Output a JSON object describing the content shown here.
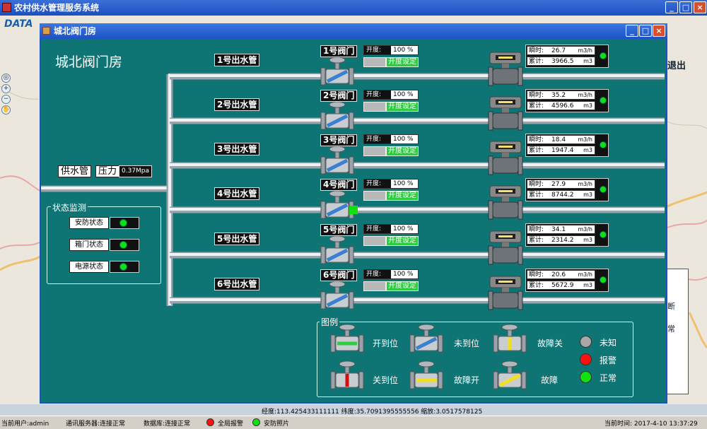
{
  "app": {
    "title": "农村供水管理服务系统",
    "logo": "DATA",
    "exit": "退出"
  },
  "map_labels": {
    "right_1": "断",
    "right_2": "常"
  },
  "window": {
    "title": "城北阀门房",
    "heading": "城北阀门房"
  },
  "supply": {
    "label": "供水管",
    "pressure_label": "压力",
    "pressure_value": "0.37Mpa"
  },
  "status_panel": {
    "title": "状态监测",
    "items": [
      {
        "label": "安防状态"
      },
      {
        "label": "箱门状态"
      },
      {
        "label": "电源状态"
      }
    ]
  },
  "rows": [
    {
      "pipe": "1号出水管",
      "valve": "1号阀门",
      "open_label": "开度:",
      "open_value": "100 %",
      "set_label": "开度设定",
      "inst_label": "瞬时:",
      "inst_value": "26.7",
      "inst_unit": "m3/h",
      "total_label": "累计:",
      "total_value": "3966.5",
      "total_unit": "m3",
      "valve_state": "未到位"
    },
    {
      "pipe": "2号出水管",
      "valve": "2号阀门",
      "open_label": "开度:",
      "open_value": "100 %",
      "set_label": "开度设定",
      "inst_label": "瞬时:",
      "inst_value": "35.2",
      "inst_unit": "m3/h",
      "total_label": "累计:",
      "total_value": "4596.6",
      "total_unit": "m3",
      "valve_state": "未到位"
    },
    {
      "pipe": "3号出水管",
      "valve": "3号阀门",
      "open_label": "开度:",
      "open_value": "100 %",
      "set_label": "开度设定",
      "inst_label": "瞬时:",
      "inst_value": "18.4",
      "inst_unit": "m3/h",
      "total_label": "累计:",
      "total_value": "1947.4",
      "total_unit": "m3",
      "valve_state": "未到位"
    },
    {
      "pipe": "4号出水管",
      "valve": "4号阀门",
      "open_label": "开度:",
      "open_value": "100 %",
      "set_label": "开度设定",
      "inst_label": "瞬时:",
      "inst_value": "27.9",
      "inst_unit": "m3/h",
      "total_label": "累计:",
      "total_value": "8744.2",
      "total_unit": "m3",
      "valve_state": "未到位"
    },
    {
      "pipe": "5号出水管",
      "valve": "5号阀门",
      "open_label": "开度:",
      "open_value": "100 %",
      "set_label": "开度设定",
      "inst_label": "瞬时:",
      "inst_value": "34.1",
      "inst_unit": "m3/h",
      "total_label": "累计:",
      "total_value": "2314.2",
      "total_unit": "m3",
      "valve_state": "未到位"
    },
    {
      "pipe": "6号出水管",
      "valve": "6号阀门",
      "open_label": "开度:",
      "open_value": "100 %",
      "set_label": "开度设定",
      "inst_label": "瞬时:",
      "inst_value": "20.6",
      "inst_unit": "m3/h",
      "total_label": "累计:",
      "total_value": "5672.9",
      "total_unit": "m3",
      "valve_state": "未到位"
    }
  ],
  "legend": {
    "title": "图例",
    "items": [
      {
        "label": "开到位",
        "color": "#2ecc40"
      },
      {
        "label": "未到位",
        "color": "#3a7fd0"
      },
      {
        "label": "故障关",
        "color": "#f0e020"
      },
      {
        "label": "关到位",
        "color": "#d01010"
      },
      {
        "label": "故障开",
        "color": "#f0e020"
      },
      {
        "label": "故障",
        "color": "#f0e020"
      }
    ],
    "status": [
      {
        "label": "未知",
        "color": "#a8a8a8"
      },
      {
        "label": "报警",
        "color": "#ff1010"
      },
      {
        "label": "正常",
        "color": "#11e011"
      }
    ]
  },
  "coords": "经度:113.425433111111 纬度:35.7091395555556 缩放:3.0517578125",
  "statusbar": {
    "user": "当前用户:admin",
    "comm": "通讯服务器:连接正常",
    "db": "数据库:连接正常",
    "alarm": "全局报警",
    "security": "安防照片",
    "time": "当前时间: 2017-4-10 13:37:29"
  },
  "colors": {
    "panel": "#0f7474",
    "led_ok": "#11e011",
    "led_alarm": "#ff1010"
  }
}
